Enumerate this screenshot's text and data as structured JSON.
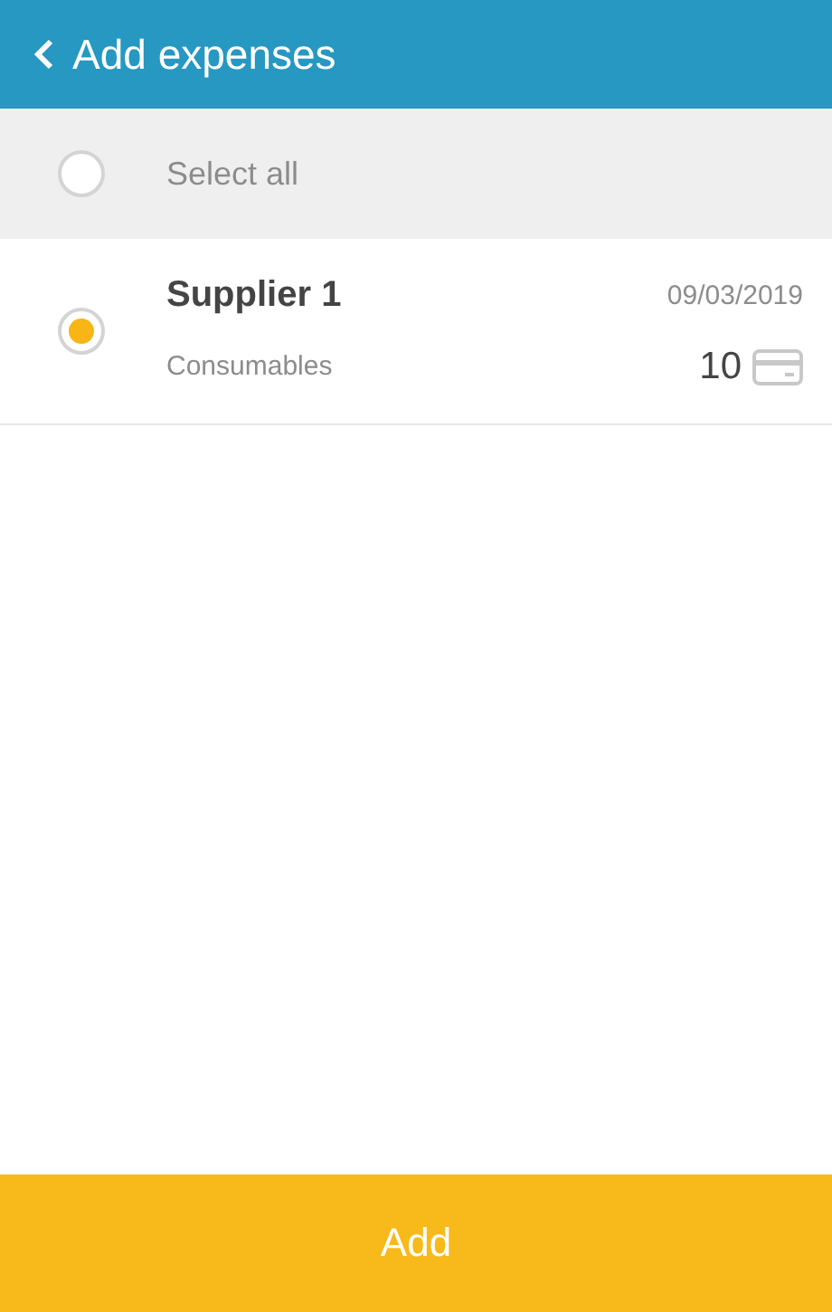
{
  "header": {
    "title": "Add expenses"
  },
  "select_all": {
    "label": "Select all",
    "checked": false
  },
  "expenses": [
    {
      "supplier": "Supplier 1",
      "date": "09/03/2019",
      "category": "Consumables",
      "amount": "10",
      "selected": true
    }
  ],
  "add_button": {
    "label": "Add"
  }
}
